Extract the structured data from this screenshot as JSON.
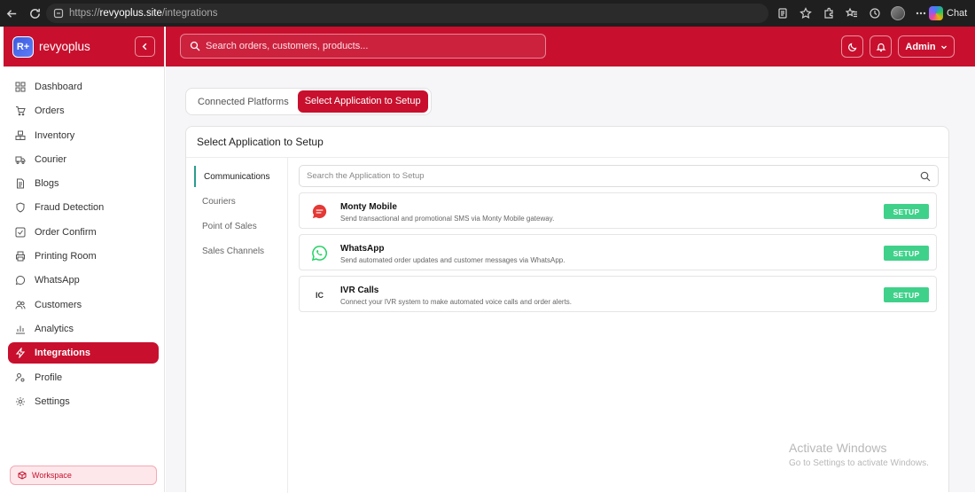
{
  "browser": {
    "url_scheme": "https://",
    "url_host": "revyoplus.site",
    "url_path": "/integrations",
    "chat_label": "Chat"
  },
  "brand": {
    "badge": "R+",
    "name": "revyoplus",
    "accent": "#c8102e"
  },
  "header": {
    "search_placeholder": "Search orders, customers, products...",
    "admin_label": "Admin"
  },
  "sidebar": {
    "items": [
      {
        "label": "Dashboard",
        "icon": "grid-icon"
      },
      {
        "label": "Orders",
        "icon": "cart-icon"
      },
      {
        "label": "Inventory",
        "icon": "boxes-icon"
      },
      {
        "label": "Courier",
        "icon": "truck-icon"
      },
      {
        "label": "Blogs",
        "icon": "document-icon"
      },
      {
        "label": "Fraud Detection",
        "icon": "shield-icon"
      },
      {
        "label": "Order Confirm",
        "icon": "check-square-icon"
      },
      {
        "label": "Printing Room",
        "icon": "printer-icon"
      },
      {
        "label": "WhatsApp",
        "icon": "chat-bubble-icon"
      },
      {
        "label": "Customers",
        "icon": "users-icon"
      },
      {
        "label": "Analytics",
        "icon": "bar-chart-icon"
      },
      {
        "label": "Integrations",
        "icon": "bolt-icon",
        "active": true
      },
      {
        "label": "Profile",
        "icon": "user-gear-icon"
      },
      {
        "label": "Settings",
        "icon": "gear-icon"
      }
    ],
    "workspace_label": "Workspace"
  },
  "tabs": [
    {
      "label": "Connected Platforms"
    },
    {
      "label": "Select Application to Setup",
      "active": true
    }
  ],
  "card": {
    "title": "Select Application to Setup",
    "categories": [
      {
        "label": "Communications",
        "active": true
      },
      {
        "label": "Couriers"
      },
      {
        "label": "Point of Sales"
      },
      {
        "label": "Sales Channels"
      }
    ],
    "search_placeholder": "Search the Application to Setup",
    "apps": [
      {
        "name": "Monty Mobile",
        "description": "Send transactional and promotional SMS via Monty Mobile gateway.",
        "icon": "monty-mobile-icon",
        "button": "SETUP"
      },
      {
        "name": "WhatsApp",
        "description": "Send automated order updates and customer messages via WhatsApp.",
        "icon": "whatsapp-icon",
        "button": "SETUP"
      },
      {
        "name": "IVR Calls",
        "description": "Connect your IVR system to make automated voice calls and order alerts.",
        "icon_text": "IC",
        "button": "SETUP"
      }
    ]
  },
  "watermark": {
    "title": "Activate Windows",
    "subtitle": "Go to Settings to activate Windows."
  }
}
